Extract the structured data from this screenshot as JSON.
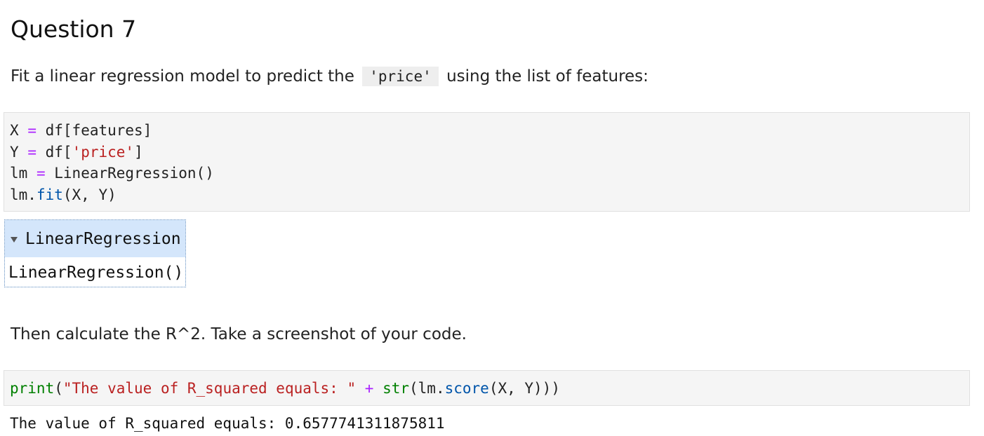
{
  "heading": "Question 7",
  "p1": {
    "before": "Fit a linear regression model to predict the",
    "code": "'price'",
    "after": "using the list of features:"
  },
  "cell1": {
    "line1": {
      "var": "X",
      "op": "=",
      "expr": "df[features]"
    },
    "line2": {
      "var": "Y",
      "op": "=",
      "pre": "df[",
      "str": "'price'",
      "post": "]"
    },
    "line3": {
      "var": "lm",
      "op": "=",
      "expr": "LinearRegression()"
    },
    "line4": {
      "obj": "lm.",
      "method": "fit",
      "args": "(X, Y)"
    }
  },
  "widget": {
    "title": "LinearRegression",
    "body": "LinearRegression()"
  },
  "p2": "Then calculate the R^2. Take a screenshot of your code.",
  "cell2": {
    "print": "print",
    "open": "(",
    "str": "\"The value of R_squared equals: \"",
    "plus": "+",
    "str_fn": "str",
    "mid": "(lm.",
    "score": "score",
    "close": "(X, Y)))"
  },
  "output": "The value of R_squared equals: 0.6577741311875811"
}
